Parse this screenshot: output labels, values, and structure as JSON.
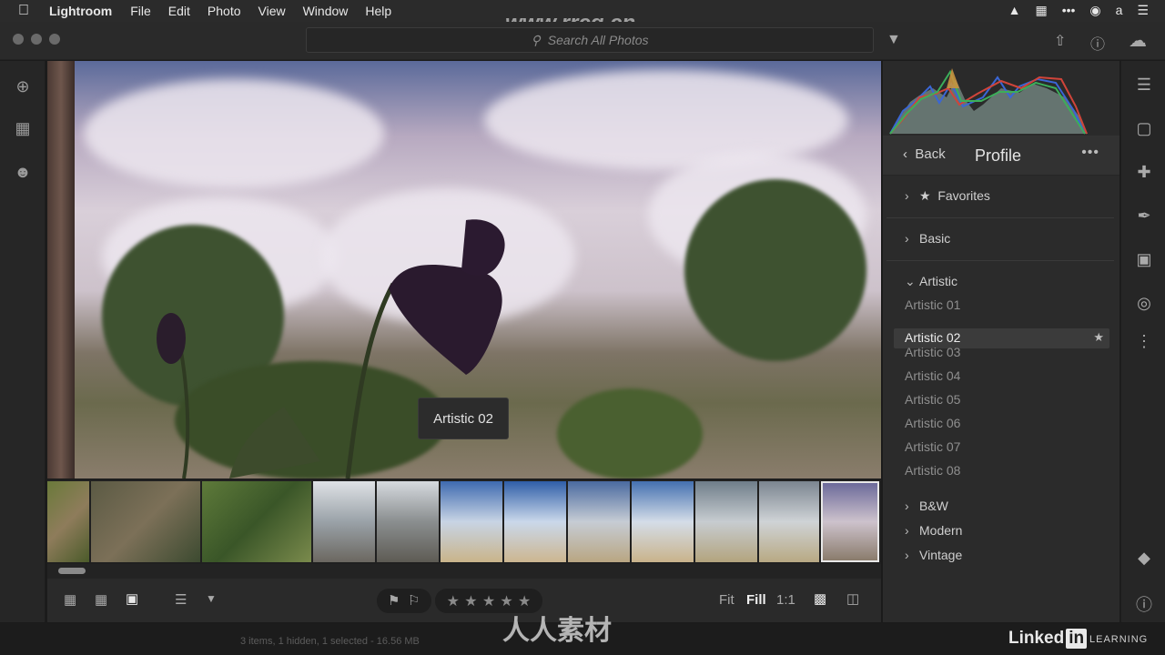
{
  "menubar": {
    "app": "Lightroom",
    "items": [
      "File",
      "Edit",
      "Photo",
      "View",
      "Window",
      "Help"
    ]
  },
  "toolbar": {
    "search_placeholder": "Search All Photos"
  },
  "watermark": {
    "top": "www.rrcg.cn",
    "bottom": "人人素材"
  },
  "tooltip": "Artistic 02",
  "bottombar": {
    "fit": "Fit",
    "fill": "Fill",
    "ratio": "1:1"
  },
  "profile_panel": {
    "back_label": "Back",
    "title": "Profile",
    "more": "•••",
    "groups": {
      "favorites": "Favorites",
      "basic": "Basic",
      "artistic": "Artistic",
      "bw": "B&W",
      "modern": "Modern",
      "vintage": "Vintage"
    },
    "artistic_items": [
      "Artistic 01",
      "Artistic 02",
      "Artistic 03",
      "Artistic 04",
      "Artistic 05",
      "Artistic 06",
      "Artistic 07",
      "Artistic 08"
    ],
    "selected": "Artistic 02"
  },
  "status": {
    "text": "3 items, 1 hidden, 1 selected - 16.56 MB"
  },
  "brand": {
    "linkedin": "Linked",
    "in": "in",
    "learning": "LEARNING"
  },
  "colors": {
    "accent": "#ececec",
    "panel_bg": "#2b2b2b",
    "selected_row": "#3b3b3b"
  }
}
